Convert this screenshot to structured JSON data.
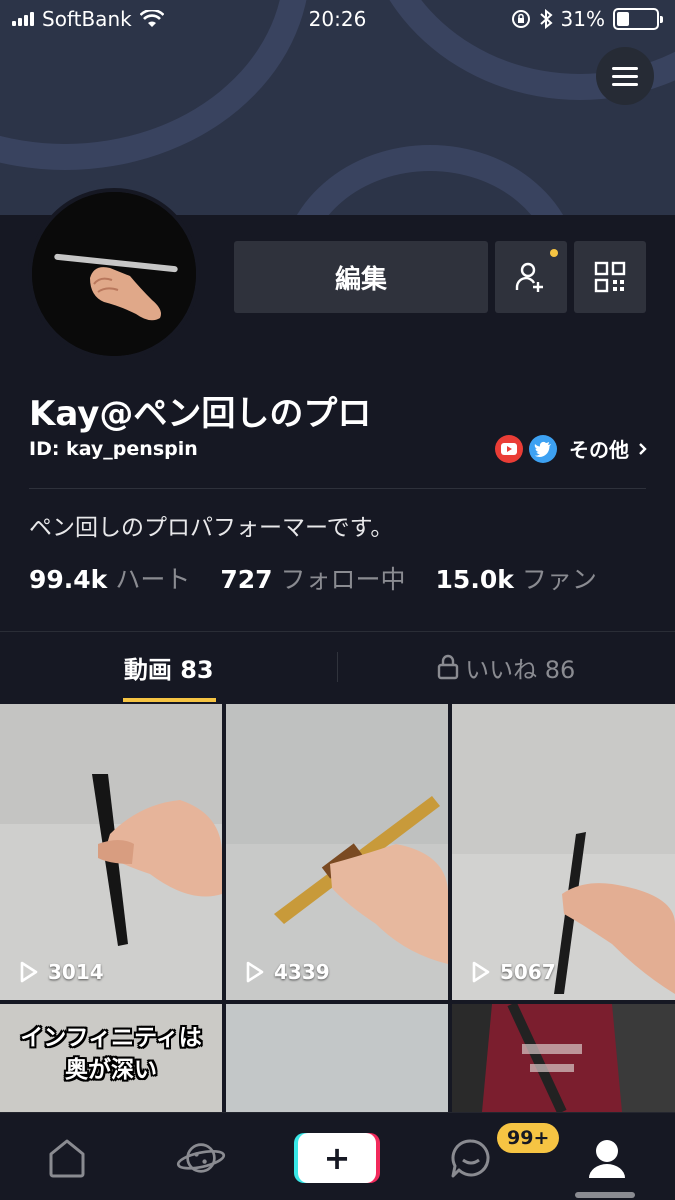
{
  "status_bar": {
    "carrier": "SoftBank",
    "time": "20:26",
    "battery": "31%"
  },
  "profile": {
    "edit_label": "編集",
    "name": "Kay@ペン回しのプロ",
    "id": "ID: kay_penspin",
    "others_label": "その他",
    "bio": "ペン回しのプロパフォーマーです。"
  },
  "stats": [
    {
      "value": "99.4k",
      "label": "ハート"
    },
    {
      "value": "727",
      "label": "フォロー中"
    },
    {
      "value": "15.0k",
      "label": "ファン"
    }
  ],
  "tabs": {
    "videos": "動画 83",
    "likes": "いいね 86"
  },
  "videos": [
    {
      "plays": "3014"
    },
    {
      "plays": "4339"
    },
    {
      "plays": "5067"
    },
    {
      "caption_line1": "インフィニティは",
      "caption_line2": "奥が深い"
    },
    {},
    {}
  ],
  "bottom_nav": {
    "plus_label": "+",
    "inbox_badge": "99+"
  },
  "colors": {
    "background": "#161823",
    "accent": "#f6c443",
    "button": "#2f323c",
    "muted": "#8a8b91"
  }
}
